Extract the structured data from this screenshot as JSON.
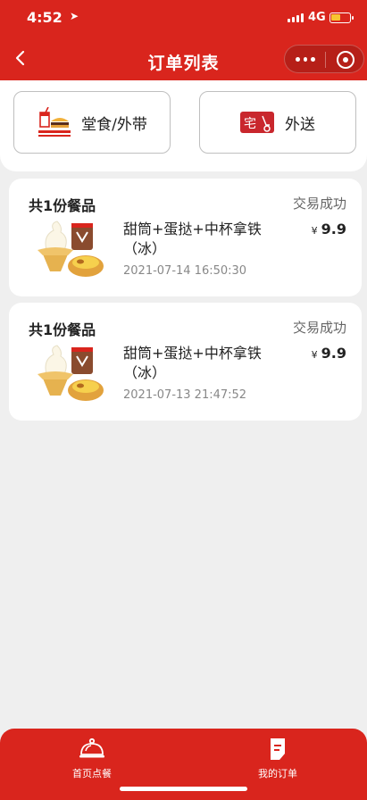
{
  "status_bar": {
    "time": "4:52",
    "network": "4G"
  },
  "nav": {
    "title": "订单列表"
  },
  "modes": [
    {
      "label": "堂食/外带"
    },
    {
      "label": "外送",
      "badge": "宅"
    }
  ],
  "orders": [
    {
      "count_label": "共1份餐品",
      "status": "交易成功",
      "name": "甜筒+蛋挞+中杯拿铁（冰）",
      "currency": "¥",
      "price": "9.9",
      "time": "2021-07-14 16:50:30"
    },
    {
      "count_label": "共1份餐品",
      "status": "交易成功",
      "name": "甜筒+蛋挞+中杯拿铁（冰）",
      "currency": "¥",
      "price": "9.9",
      "time": "2021-07-13 21:47:52"
    }
  ],
  "tabbar": {
    "items": [
      {
        "label": "首页点餐",
        "icon": "cloche-icon"
      },
      {
        "label": "我的订单",
        "icon": "order-doc-icon"
      }
    ]
  },
  "colors": {
    "brand_red": "#d9251d",
    "background": "#efefef"
  }
}
